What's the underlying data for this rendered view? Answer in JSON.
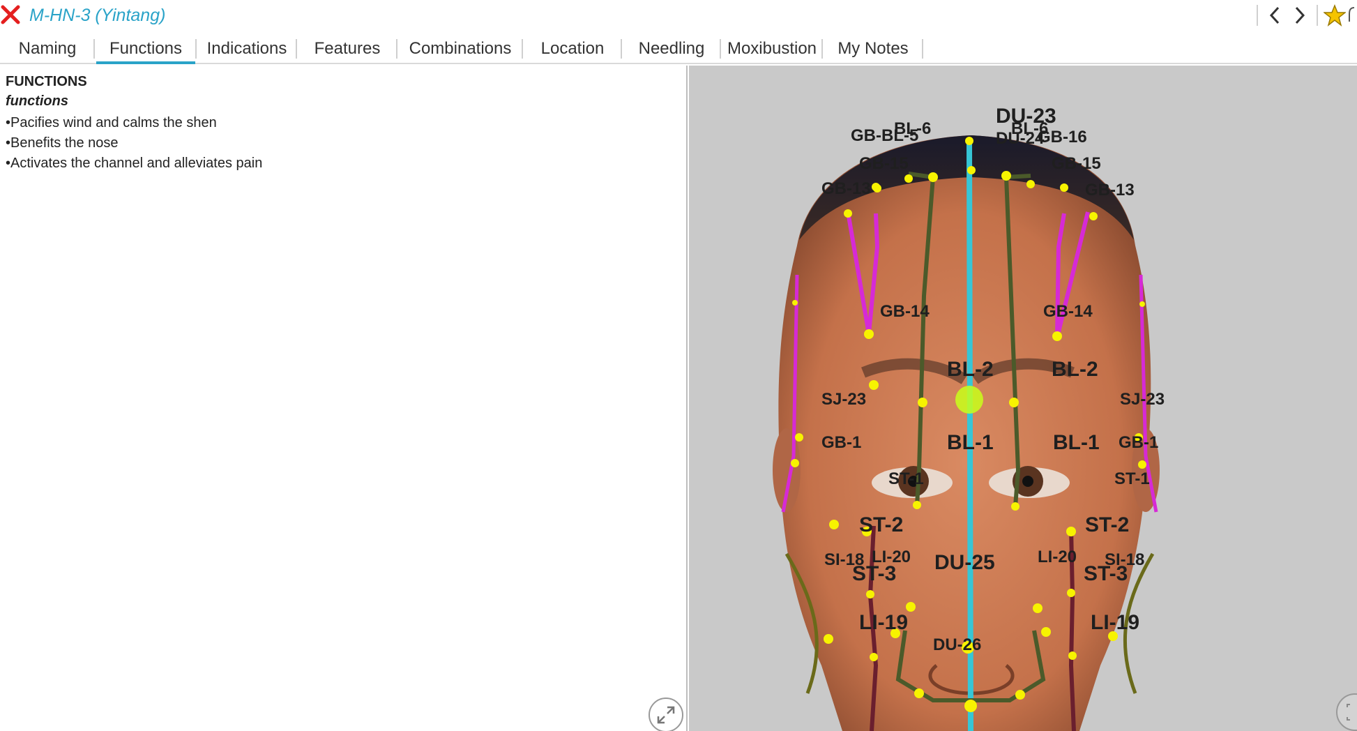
{
  "window": {
    "title": "M-HN-3 (Yintang)"
  },
  "toolbar": {
    "close_icon": "close-x-icon",
    "back_icon": "chevron-left-icon",
    "forward_icon": "chevron-right-icon",
    "favorite_icon": "star-icon",
    "colors": {
      "close": "#e41f1f",
      "title": "#2aa3c8",
      "star": "#f5c400"
    }
  },
  "tabs": [
    {
      "label": "Naming",
      "active": false
    },
    {
      "label": "Functions",
      "active": true
    },
    {
      "label": "Indications",
      "active": false
    },
    {
      "label": "Features",
      "active": false
    },
    {
      "label": "Combinations",
      "active": false
    },
    {
      "label": "Location",
      "active": false
    },
    {
      "label": "Needling",
      "active": false
    },
    {
      "label": "Moxibustion",
      "active": false
    },
    {
      "label": "My Notes",
      "active": false
    }
  ],
  "content": {
    "heading": "FUNCTIONS",
    "subheading": "functions",
    "items": [
      "•Pacifies wind and calms the shen",
      "•Benefits the nose",
      "•Activates the channel and alleviates pain"
    ]
  },
  "viewer": {
    "model": "head-front-3d",
    "highlight_point": "M-HN-3",
    "point_labels": {
      "du23": "DU-23",
      "du24": "DU-24",
      "bl6_l": "BL-6",
      "bl6_r": "BL-6",
      "bl5": "GB-BL-5",
      "gb16": "GB-16",
      "gb15_l": "GB-15",
      "gb15_r": "GB-15",
      "gb13_l": "GB-13",
      "gb13_r": "GB-13",
      "gb14_l": "GB-14",
      "gb14_r": "GB-14",
      "bl2_l": "BL-2",
      "bl2_r": "BL-2",
      "bl1_l": "BL-1",
      "bl1_r": "BL-1",
      "st1_l": "ST-1",
      "st1_r": "ST-1",
      "st2_l": "ST-2",
      "st2_r": "ST-2",
      "st3_l": "ST-3",
      "st3_r": "ST-3",
      "li20_l": "LI-20",
      "li20_r": "LI-20",
      "li19_l": "LI-19",
      "li19_r": "LI-19",
      "du25": "DU-25",
      "du26": "DU-26",
      "sj23_l": "SJ-23",
      "sj23_r": "SJ-23",
      "gb1_l": "GB-1",
      "gb1_r": "GB-1",
      "si18_l": "SI-18",
      "si18_r": "SI-18"
    },
    "colors": {
      "background": "#c9c9c9",
      "du_channel": "#36c6d6",
      "bl_channel": "#4b5a2a",
      "gb_channel": "#d62ad6",
      "st_channel": "#6a1f2e",
      "point": "#f7f300",
      "highlight": "#c8ff1a"
    },
    "expand_icon": "expand-arrows-icon"
  }
}
